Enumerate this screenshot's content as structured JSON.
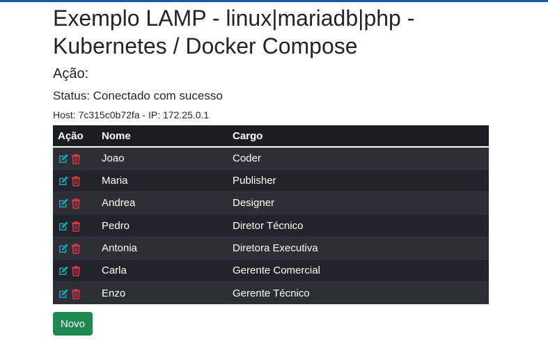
{
  "page": {
    "title": "Exemplo LAMP - linux|mariadb|php - Kubernetes / Docker Compose",
    "action_label": "Ação:",
    "status": "Status: Conectado com sucesso",
    "host": "Host: 7c315c0b72fa - IP: 172.25.0.1"
  },
  "colors": {
    "accent_bar": "#1a56a6",
    "edit_icon": "#17a2b8",
    "delete_icon": "#dc3545",
    "new_button": "#1e8a52"
  },
  "icons": {
    "edit": "edit-icon",
    "delete": "trash-icon"
  },
  "table": {
    "headers": [
      "Ação",
      "Nome",
      "Cargo"
    ],
    "rows": [
      {
        "nome": "Joao",
        "cargo": "Coder"
      },
      {
        "nome": "Maria",
        "cargo": "Publisher"
      },
      {
        "nome": "Andrea",
        "cargo": "Designer"
      },
      {
        "nome": "Pedro",
        "cargo": "Diretor Técnico"
      },
      {
        "nome": "Antonia",
        "cargo": "Diretora Executiva"
      },
      {
        "nome": "Carla",
        "cargo": "Gerente Comercial"
      },
      {
        "nome": "Enzo",
        "cargo": "Gerente Técnico"
      }
    ]
  },
  "buttons": {
    "new_label": "Novo"
  }
}
